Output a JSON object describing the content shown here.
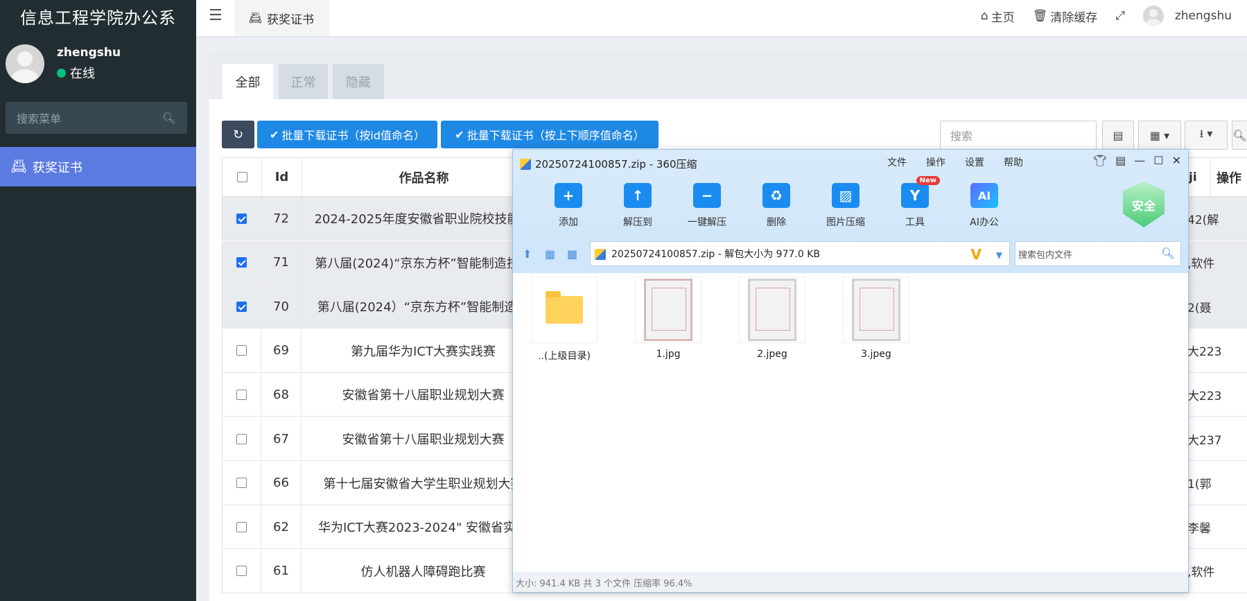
{
  "sidebar": {
    "brand": "信息工程学院办公系",
    "user": {
      "name": "zhengshu",
      "status": "在线"
    },
    "search_placeholder": "搜索菜单",
    "menu": [
      {
        "label": "获奖证书"
      }
    ]
  },
  "navbar": {
    "tab": "获奖证书",
    "home": "主页",
    "clear_cache": "清除缓存",
    "username": "zhengshu"
  },
  "content": {
    "tabs": [
      "全部",
      "正常",
      "隐藏"
    ],
    "btn_batch_id": "批量下载证书（按id值命名）",
    "btn_batch_order": "批量下载证书（按上下顺序值命名）",
    "search_placeholder": "搜索"
  },
  "table": {
    "headers": {
      "id": "Id",
      "name": "作品名称",
      "frag": "ji",
      "ops": "操作"
    },
    "rows": [
      {
        "id": "72",
        "name": "2024-2025年度安徽省职业院校技能大",
        "frag": "42(解",
        "checked": true
      },
      {
        "id": "71",
        "name": "第八届(2024)“京东方杯”智能制造技能",
        "frag": ",软件",
        "checked": true
      },
      {
        "id": "70",
        "name": "第八届(2024）“京东方杯”智能制造技",
        "frag": "2(聂",
        "checked": true
      },
      {
        "id": "69",
        "name": "第九届华为ICT大赛实践赛",
        "frag": "大223",
        "checked": false
      },
      {
        "id": "68",
        "name": "安徽省第十八届职业规划大赛",
        "frag": "大223",
        "checked": false
      },
      {
        "id": "67",
        "name": "安徽省第十八届职业规划大赛",
        "frag": "大237",
        "checked": false
      },
      {
        "id": "66",
        "name": "第十七届安徽省大学生职业规划大赛",
        "frag": "1(郭",
        "checked": false
      },
      {
        "id": "62",
        "name": "华为ICT大赛2023-2024\" 安徽省实践",
        "frag": "李馨",
        "checked": false
      },
      {
        "id": "61",
        "name": "仿人机器人障碍跑比赛",
        "frag": ",软件",
        "checked": false
      }
    ]
  },
  "zip_window": {
    "title": "20250724100857.zip - 360压缩",
    "menu": [
      "文件",
      "操作",
      "设置",
      "帮助"
    ],
    "tools": [
      {
        "label": "添加",
        "icon": "folder-plus-icon"
      },
      {
        "label": "解压到",
        "icon": "folder-upload-icon"
      },
      {
        "label": "一键解压",
        "icon": "folder-minus-icon"
      },
      {
        "label": "删除",
        "icon": "recycle-icon"
      },
      {
        "label": "图片压缩",
        "icon": "image-compress-icon"
      },
      {
        "label": "工具",
        "icon": "tools-icon",
        "badge": "New"
      },
      {
        "label": "AI办公",
        "icon": "ai-icon",
        "glyph": "AI"
      }
    ],
    "safe_label": "安全",
    "address": "20250724100857.zip - 解包大小为 977.0 KB",
    "search_placeholder": "搜索包内文件",
    "files": [
      {
        "name": "..(上级目录)",
        "kind": "folder"
      },
      {
        "name": "1.jpg",
        "kind": "image"
      },
      {
        "name": "2.jpeg",
        "kind": "image"
      },
      {
        "name": "3.jpeg",
        "kind": "image"
      }
    ],
    "status": "大小: 941.4 KB 共 3 个文件 压缩率 96.4%"
  }
}
